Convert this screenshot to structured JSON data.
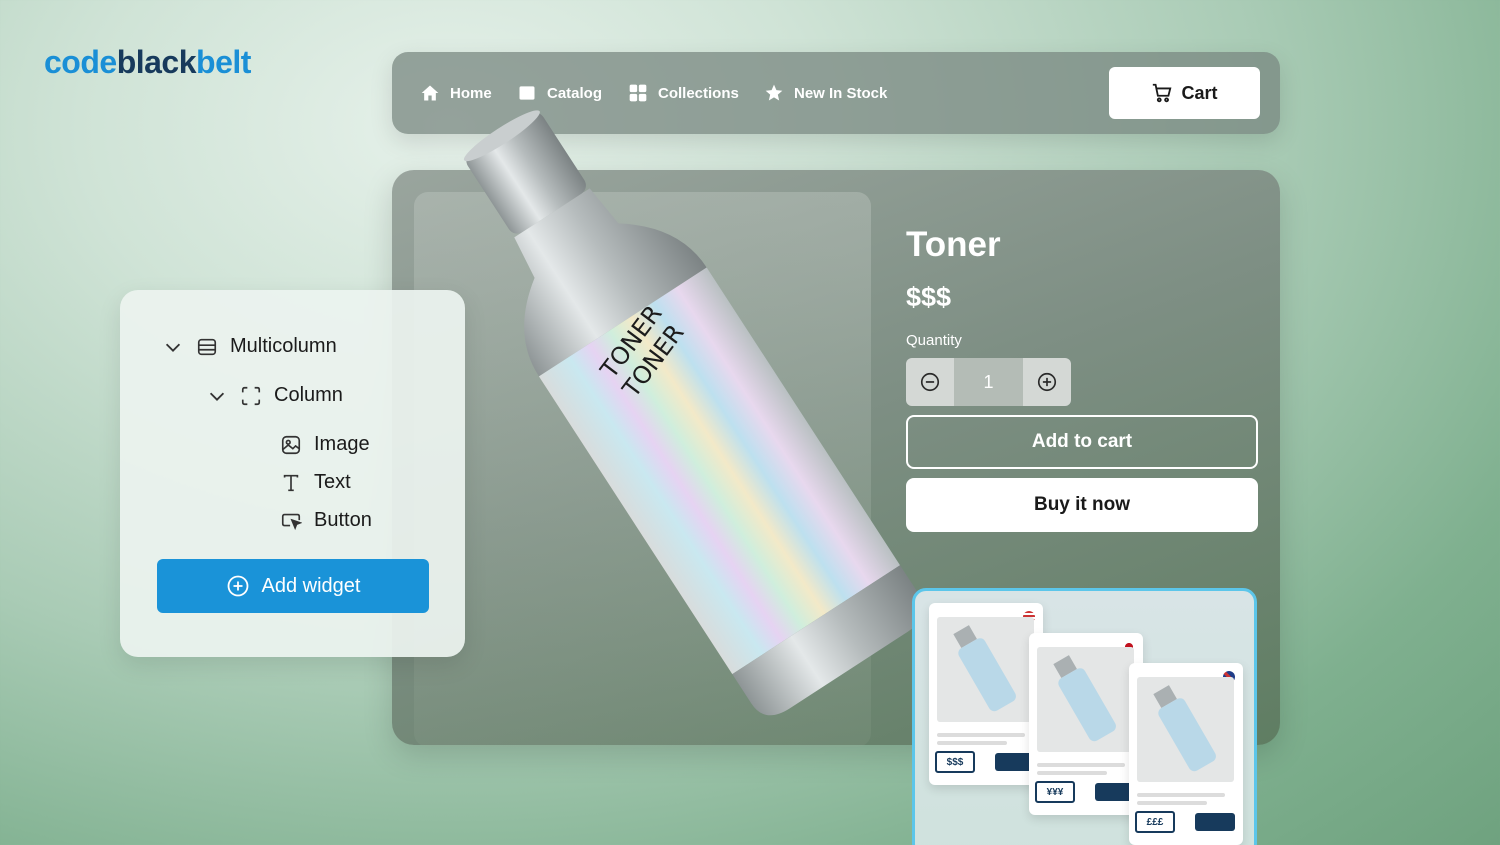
{
  "logo": {
    "part1": "code",
    "part2": "black",
    "part3": "belt"
  },
  "nav": {
    "items": [
      {
        "label": "Home",
        "icon": "home-icon"
      },
      {
        "label": "Catalog",
        "icon": "catalog-icon"
      },
      {
        "label": "Collections",
        "icon": "collections-icon"
      },
      {
        "label": "New In Stock",
        "icon": "star-icon"
      }
    ],
    "cart_label": "Cart"
  },
  "product": {
    "title": "Toner",
    "price": "$$$",
    "quantity_label": "Quantity",
    "quantity_value": "1",
    "add_to_cart": "Add to cart",
    "buy_now": "Buy it now",
    "bottle_text_line1": "TONER",
    "bottle_text_line2": "TONER"
  },
  "widget_tree": {
    "items": [
      {
        "label": "Multicolumn",
        "icon": "multicolumn-icon",
        "expanded": true
      },
      {
        "label": "Column",
        "icon": "column-icon",
        "expanded": true
      },
      {
        "label": "Image",
        "icon": "image-icon"
      },
      {
        "label": "Text",
        "icon": "text-icon"
      },
      {
        "label": "Button",
        "icon": "button-icon"
      }
    ],
    "add_widget": "Add widget"
  },
  "markets": [
    {
      "price": "$$$",
      "flag": "us-flag"
    },
    {
      "price": "¥¥¥",
      "flag": "jp-flag"
    },
    {
      "price": "£££",
      "flag": "uk-flag"
    }
  ],
  "colors": {
    "brand_blue": "#1a93d8",
    "brand_navy": "#173a5c",
    "market_border": "#5cc6ea"
  }
}
